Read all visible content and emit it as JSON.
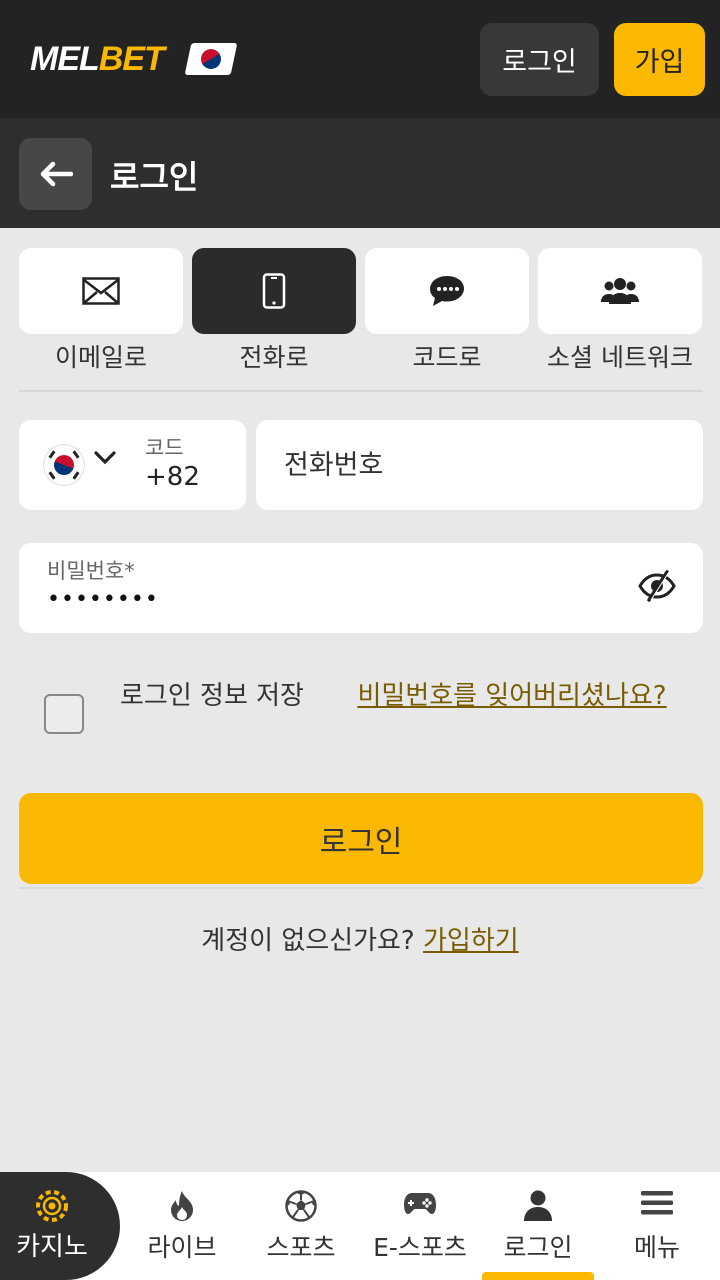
{
  "header": {
    "logo_mel": "MEL",
    "logo_bet": "BET",
    "login_button": "로그인",
    "join_button": "가입"
  },
  "subheader": {
    "title": "로그인"
  },
  "methods": [
    {
      "label": "이메일로",
      "icon": "envelope-icon",
      "active": false
    },
    {
      "label": "전화로",
      "icon": "phone-icon",
      "active": true
    },
    {
      "label": "코드로",
      "icon": "chat-bubble-icon",
      "active": false
    },
    {
      "label": "소셜 네트워크",
      "icon": "users-group-icon",
      "active": false
    }
  ],
  "phone_form": {
    "code_label": "코드",
    "code_value": "+82",
    "phone_placeholder": "전화번호"
  },
  "password": {
    "label": "비밀번호*",
    "value": "••••••••"
  },
  "remember_label": "로그인 정보 저장",
  "forgot_link": "비밀번호를 잊어버리셨나요?",
  "login_button": "로그인",
  "signup": {
    "text": "계정이 없으신가요?",
    "link": "가입하기"
  },
  "bottom_nav": [
    {
      "label": "카지노",
      "icon": "casino-chip-icon"
    },
    {
      "label": "라이브",
      "icon": "flame-icon"
    },
    {
      "label": "스포츠",
      "icon": "soccer-ball-icon"
    },
    {
      "label": "E-스포츠",
      "icon": "gamepad-icon"
    },
    {
      "label": "로그인",
      "icon": "user-icon",
      "active": true
    },
    {
      "label": "메뉴",
      "icon": "hamburger-icon"
    }
  ],
  "colors": {
    "accent": "#fbb800",
    "header_bg": "#232323",
    "subheader_bg": "#2e2e2e",
    "link": "#7a5c00"
  }
}
